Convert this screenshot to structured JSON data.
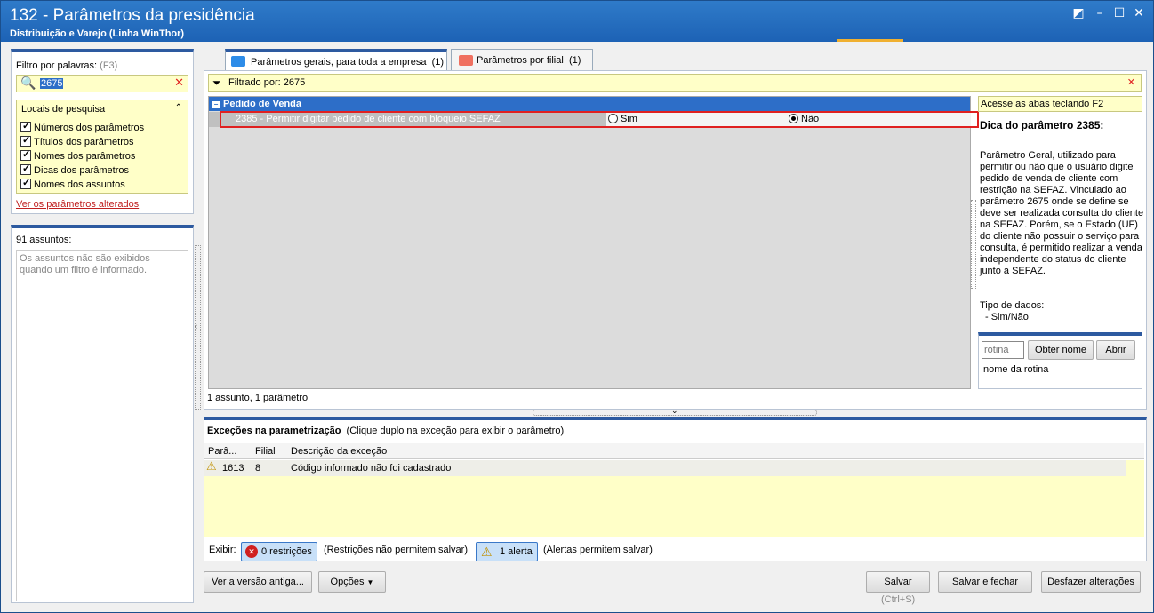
{
  "window": {
    "title": "132 - Parâmetros da presidência",
    "subtitle": "Distribuição e Varejo (Linha WinThor)"
  },
  "filter": {
    "label": "Filtro por palavras:",
    "shortcut": "(F3)",
    "value": "2675"
  },
  "search_places": {
    "title": "Locais de pesquisa",
    "items": [
      "Números dos parâmetros",
      "Títulos dos parâmetros",
      "Nomes dos parâmetros",
      "Dicas dos parâmetros",
      "Nomes dos assuntos"
    ]
  },
  "changed_link": "Ver os parâmetros alterados",
  "subjects": {
    "count_label": "91 assuntos:",
    "message": "Os assuntos não são exibidos quando um filtro é informado."
  },
  "tabs": [
    {
      "label": "Parâmetros gerais, para toda a empresa",
      "count": "(1)"
    },
    {
      "label": "Parâmetros por filial",
      "count": "(1)"
    }
  ],
  "filtered": "Filtrado por: 2675",
  "group": {
    "name": "Pedido de Venda",
    "row": {
      "text": "2385 - Permitir digitar pedido de cliente com bloqueio SEFAZ",
      "opt_yes": "Sim",
      "opt_no": "Não",
      "selected": "Não"
    }
  },
  "list_status": "1 assunto, 1 parâmetro",
  "tip": {
    "hint": "Acesse as abas teclando F2",
    "title": "Dica do parâmetro 2385:",
    "body": "Parâmetro Geral, utilizado para permitir ou não que o usuário digite pedido de venda de cliente com restrição na SEFAZ. Vinculado ao parâmetro 2675 onde se define se deve ser realizada consulta do cliente na SEFAZ. Porém, se o Estado (UF) do cliente não possuir o serviço para consulta, é permitido realizar a venda independente do status do cliente junto a SEFAZ.",
    "type_label": "Tipo de dados:",
    "type_value": "- Sim/Não"
  },
  "routine": {
    "placeholder": "rotina",
    "get_name": "Obter nome",
    "open": "Abrir",
    "name_label": "nome da rotina"
  },
  "exceptions": {
    "title": "Exceções na parametrização",
    "hint": "(Clique duplo na exceção para exibir o parâmetro)",
    "columns": [
      "Parâ...",
      "Filial",
      "Descrição da exceção"
    ],
    "rows": [
      {
        "param": "1613",
        "filial": "8",
        "desc": "Código informado não foi cadastrado"
      }
    ]
  },
  "show": {
    "label": "Exibir:",
    "restrictions": "0 restrições",
    "restrictions_note": "(Restrições não permitem salvar)",
    "alerts": "1 alerta",
    "alerts_note": "(Alertas permitem salvar)"
  },
  "footer": {
    "old_version": "Ver a versão antiga...",
    "options": "Opções",
    "save": "Salvar",
    "save_shortcut": "(Ctrl+S)",
    "save_close": "Salvar e fechar",
    "undo": "Desfazer alterações"
  },
  "colors": {
    "title_bar": "#1d62b5",
    "accent": "#2d5aa0",
    "highlight": "#e02020",
    "yellow": "#ffffc8"
  }
}
